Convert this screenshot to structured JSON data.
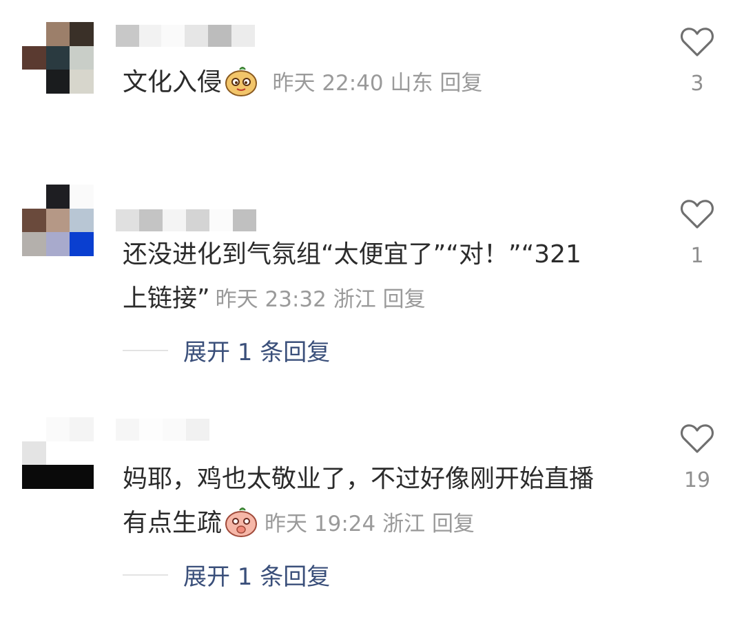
{
  "comments": [
    {
      "text": "文化入侵",
      "emoji": "mascot-sly-face-emoji",
      "time": "昨天 22:40",
      "location": "山东",
      "reply_label": "回复",
      "likes": "3"
    },
    {
      "text_line1": "还没进化到气氛组“太便宜了”“对！”“321",
      "text_line2": "上链接”",
      "time": "昨天 23:32",
      "location": "浙江",
      "reply_label": "回复",
      "likes": "1",
      "expand_label": "展开 1 条回复"
    },
    {
      "text_line1": "妈耶，鸡也太敬业了，不过好像刚开始直播",
      "text_line2": "有点生疏",
      "emoji": "mascot-shy-face-emoji",
      "time": "昨天 19:24",
      "location": "浙江",
      "reply_label": "回复",
      "likes": "19",
      "expand_label": "展开 1 条回复"
    }
  ],
  "colors": {
    "meta_gray": "#9a9a9a",
    "expand_blue": "#3a4f7a",
    "text": "#2b2b2b"
  },
  "icons": {
    "like": "heart-outline-icon"
  }
}
